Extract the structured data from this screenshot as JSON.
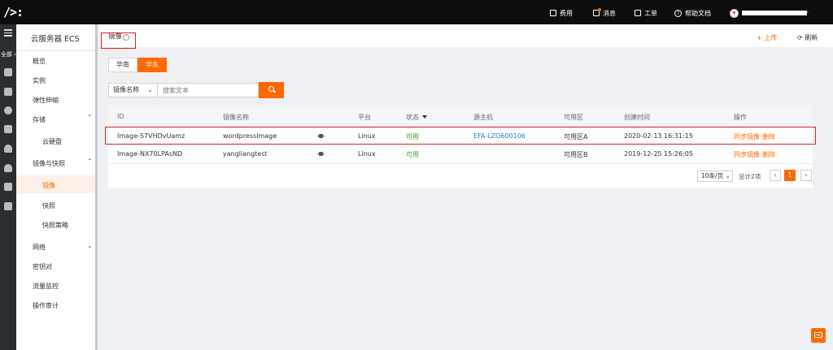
{
  "topbar": {
    "logo": "/>:",
    "items": [
      "费用",
      "消息",
      "工单",
      "帮助文档"
    ],
    "chevron": "⌄"
  },
  "rail": {
    "all_label": "全部 ›"
  },
  "sidebar": {
    "title": "云服务器 ECS",
    "items": [
      "概览",
      "实例",
      "弹性伸缩",
      "存储",
      "云硬盘",
      "镜像与快照",
      "镜像",
      "快照",
      "快照策略",
      "网络",
      "密钥对",
      "流量监控",
      "操作审计"
    ],
    "chevron": "⌄",
    "chevron_up": "⌃"
  },
  "header": {
    "title": "镜像",
    "help_icon": "?",
    "upload_label": "+ 上传",
    "refresh_label": "⟳ 刷新"
  },
  "regions": {
    "tabs": [
      "华南",
      "华东"
    ],
    "active_index": 1
  },
  "search": {
    "field": "镜像名称",
    "chevron": "⌄",
    "placeholder": "搜索文本"
  },
  "table": {
    "columns": [
      "ID",
      "镜像名称",
      "平台",
      "状态",
      "源主机",
      "可用区",
      "创建时间",
      "操作"
    ],
    "rows": [
      {
        "id": "Image-S7VHDvUamz",
        "name": "wordpressImage",
        "platform": "Linux",
        "status": "可用",
        "source": "EFA-LZO600106",
        "zone": "可用区A",
        "created": "2020-02-13 16:31:15",
        "action_sync": "同步镜像",
        "action_delete": "删除"
      },
      {
        "id": "Image-NX70LPAsND",
        "name": "yangliangtest",
        "platform": "Linux",
        "status": "可用",
        "source": "",
        "zone": "可用区B",
        "created": "2019-12-25 15:26:05",
        "action_sync": "同步镜像",
        "action_delete": "删除"
      }
    ]
  },
  "pagination": {
    "page_size": "10条/页 ⌄",
    "total": "总计2项",
    "prev": "‹",
    "next": "›",
    "current": "1"
  },
  "colors": {
    "accent": "#ff6a00",
    "available": "#3aa335",
    "link": "#1a7fd4",
    "highlight": "#e02020"
  }
}
